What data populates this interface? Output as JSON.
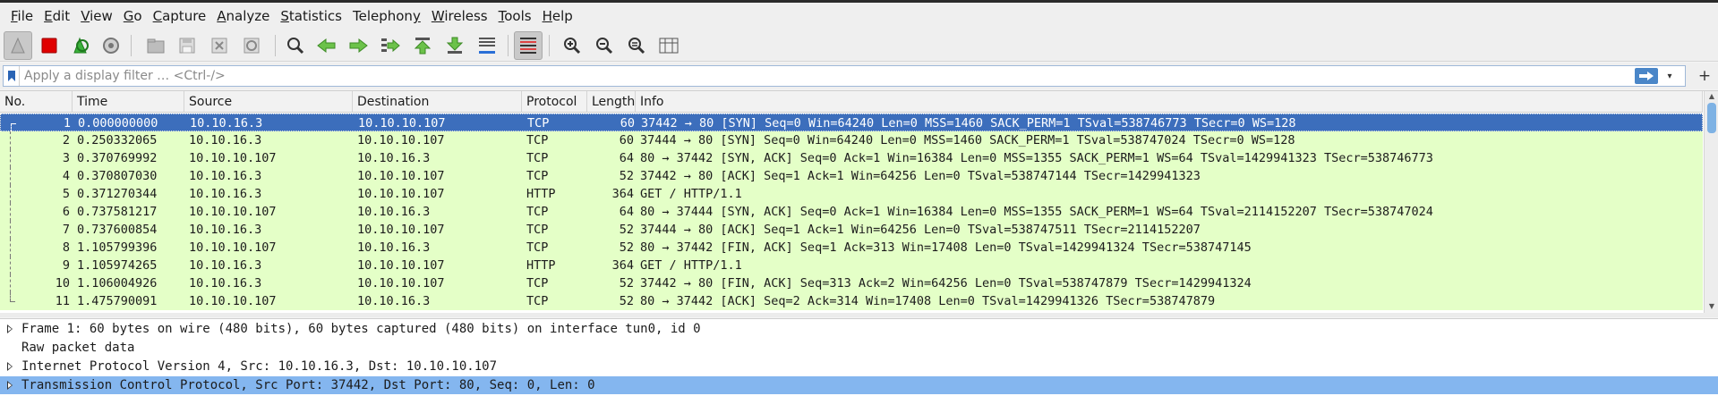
{
  "menubar": {
    "items": [
      {
        "u": "F",
        "rest": "ile"
      },
      {
        "u": "E",
        "rest": "dit"
      },
      {
        "u": "V",
        "rest": "iew"
      },
      {
        "u": "G",
        "rest": "o"
      },
      {
        "u": "C",
        "rest": "apture"
      },
      {
        "u": "A",
        "rest": "nalyze"
      },
      {
        "u": "S",
        "rest": "tatistics"
      },
      {
        "u": "",
        "rest": "Telephon",
        "tail_u": "y",
        "tail": ""
      },
      {
        "u": "W",
        "rest": "ireless"
      },
      {
        "u": "T",
        "rest": "ools"
      },
      {
        "u": "H",
        "rest": "elp"
      }
    ]
  },
  "toolbar": {
    "icons": [
      "shark-fin-icon",
      "stop-capture-icon",
      "restart-capture-icon",
      "capture-options-icon",
      "open-file-icon",
      "save-file-icon",
      "close-file-icon",
      "reload-file-icon",
      "find-packet-icon",
      "go-back-icon",
      "go-forward-icon",
      "go-to-packet-icon",
      "first-packet-icon",
      "last-packet-icon",
      "autoscroll-icon",
      "colorize-icon",
      "zoom-in-icon",
      "zoom-out-icon",
      "zoom-normal-icon",
      "resize-columns-icon"
    ]
  },
  "filter": {
    "placeholder": "Apply a display filter … <Ctrl-/>",
    "value": ""
  },
  "packet_list": {
    "columns": [
      "No.",
      "Time",
      "Source",
      "Destination",
      "Protocol",
      "Length",
      "Info"
    ],
    "rows": [
      {
        "no": "1",
        "time": "0.000000000",
        "src": "10.10.16.3",
        "dst": "10.10.10.107",
        "proto": "TCP",
        "len": "60",
        "info": "37442 → 80 [SYN] Seq=0 Win=64240 Len=0 MSS=1460 SACK_PERM=1 TSval=538746773 TSecr=0 WS=128"
      },
      {
        "no": "2",
        "time": "0.250332065",
        "src": "10.10.16.3",
        "dst": "10.10.10.107",
        "proto": "TCP",
        "len": "60",
        "info": "37444 → 80 [SYN] Seq=0 Win=64240 Len=0 MSS=1460 SACK_PERM=1 TSval=538747024 TSecr=0 WS=128"
      },
      {
        "no": "3",
        "time": "0.370769992",
        "src": "10.10.10.107",
        "dst": "10.10.16.3",
        "proto": "TCP",
        "len": "64",
        "info": "80 → 37442 [SYN, ACK] Seq=0 Ack=1 Win=16384 Len=0 MSS=1355 SACK_PERM=1 WS=64 TSval=1429941323 TSecr=538746773"
      },
      {
        "no": "4",
        "time": "0.370807030",
        "src": "10.10.16.3",
        "dst": "10.10.10.107",
        "proto": "TCP",
        "len": "52",
        "info": "37442 → 80 [ACK] Seq=1 Ack=1 Win=64256 Len=0 TSval=538747144 TSecr=1429941323"
      },
      {
        "no": "5",
        "time": "0.371270344",
        "src": "10.10.16.3",
        "dst": "10.10.10.107",
        "proto": "HTTP",
        "len": "364",
        "info": "GET / HTTP/1.1"
      },
      {
        "no": "6",
        "time": "0.737581217",
        "src": "10.10.10.107",
        "dst": "10.10.16.3",
        "proto": "TCP",
        "len": "64",
        "info": "80 → 37444 [SYN, ACK] Seq=0 Ack=1 Win=16384 Len=0 MSS=1355 SACK_PERM=1 WS=64 TSval=2114152207 TSecr=538747024"
      },
      {
        "no": "7",
        "time": "0.737600854",
        "src": "10.10.16.3",
        "dst": "10.10.10.107",
        "proto": "TCP",
        "len": "52",
        "info": "37444 → 80 [ACK] Seq=1 Ack=1 Win=64256 Len=0 TSval=538747511 TSecr=2114152207"
      },
      {
        "no": "8",
        "time": "1.105799396",
        "src": "10.10.10.107",
        "dst": "10.10.16.3",
        "proto": "TCP",
        "len": "52",
        "info": "80 → 37442 [FIN, ACK] Seq=1 Ack=313 Win=17408 Len=0 TSval=1429941324 TSecr=538747145"
      },
      {
        "no": "9",
        "time": "1.105974265",
        "src": "10.10.16.3",
        "dst": "10.10.10.107",
        "proto": "HTTP",
        "len": "364",
        "info": "GET / HTTP/1.1"
      },
      {
        "no": "10",
        "time": "1.106004926",
        "src": "10.10.16.3",
        "dst": "10.10.10.107",
        "proto": "TCP",
        "len": "52",
        "info": "37442 → 80 [FIN, ACK] Seq=313 Ack=2 Win=64256 Len=0 TSval=538747879 TSecr=1429941324"
      },
      {
        "no": "11",
        "time": "1.475790091",
        "src": "10.10.10.107",
        "dst": "10.10.16.3",
        "proto": "TCP",
        "len": "52",
        "info": "80 → 37442 [ACK] Seq=2 Ack=314 Win=17408 Len=0 TSval=1429941326 TSecr=538747879"
      }
    ],
    "selected_row": 1,
    "row_color": "#e4ffc7",
    "selected_color": "#3c6ebc"
  },
  "details": {
    "lines": [
      {
        "text": "Frame 1: 60 bytes on wire (480 bits), 60 bytes captured (480 bits) on interface tun0, id 0",
        "expandable": true,
        "selected": false
      },
      {
        "text": "Raw packet data",
        "expandable": false,
        "selected": false
      },
      {
        "text": "Internet Protocol Version 4, Src: 10.10.16.3, Dst: 10.10.10.107",
        "expandable": true,
        "selected": false
      },
      {
        "text": "Transmission Control Protocol, Src Port: 37442, Dst Port: 80, Seq: 0, Len: 0",
        "expandable": true,
        "selected": true
      }
    ],
    "selected_color": "#84b6ef"
  }
}
